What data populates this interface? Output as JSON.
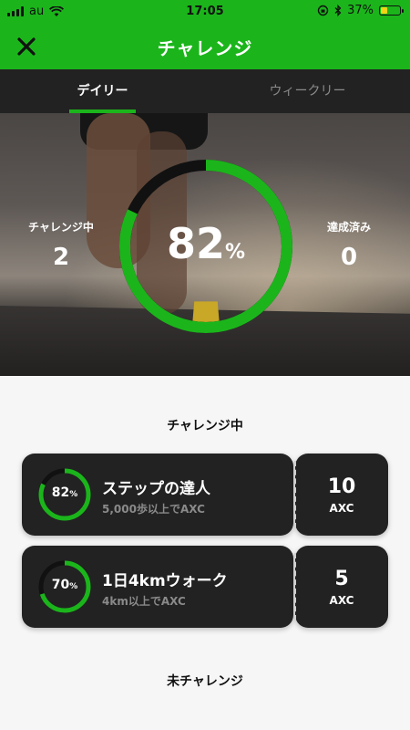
{
  "status": {
    "carrier": "au",
    "time": "17:05",
    "battery": "37%"
  },
  "header": {
    "title": "チャレンジ",
    "close_icon": "close-icon"
  },
  "tabs": [
    {
      "label": "デイリー",
      "active": true
    },
    {
      "label": "ウィークリー",
      "active": false
    }
  ],
  "summary": {
    "progress_label": "82",
    "progress_unit": "%",
    "progress_fraction": 0.82,
    "in_progress_label": "チャレンジ中",
    "in_progress_value": "2",
    "completed_label": "達成済み",
    "completed_value": "0"
  },
  "sections": {
    "active_title": "チャレンジ中",
    "pending_title": "未チャレンジ"
  },
  "challenges": [
    {
      "percent": "82",
      "percent_unit": "%",
      "progress_fraction": 0.82,
      "name": "ステップの達人",
      "description": "5,000歩以上でAXC",
      "reward_amount": "10",
      "reward_unit": "AXC"
    },
    {
      "percent": "70",
      "percent_unit": "%",
      "progress_fraction": 0.7,
      "name": "1日4kmウォーク",
      "description": "4km以上でAXC",
      "reward_amount": "5",
      "reward_unit": "AXC"
    }
  ],
  "colors": {
    "accent": "#1bb51b",
    "card": "#222222",
    "track": "#111111"
  }
}
